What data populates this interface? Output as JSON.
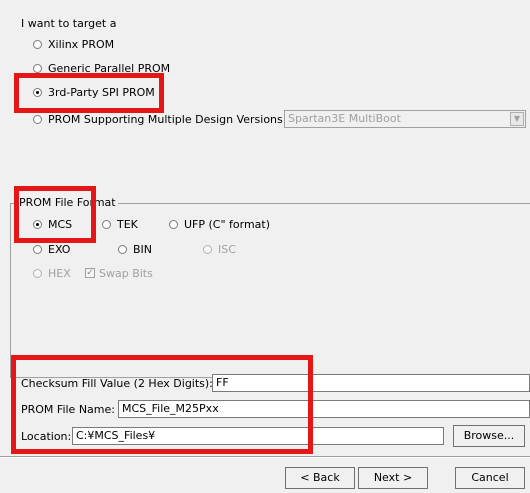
{
  "target": {
    "heading": "I want to target a",
    "options": [
      {
        "label": "Xilinx PROM",
        "selected": false,
        "enabled": true
      },
      {
        "label": "Generic Parallel PROM",
        "selected": false,
        "enabled": true
      },
      {
        "label": "3rd-Party SPI PROM",
        "selected": true,
        "enabled": true
      },
      {
        "label": "PROM Supporting Multiple Design Versions:",
        "selected": false,
        "enabled": true
      }
    ],
    "multiboot_value": "Spartan3E MultiBoot"
  },
  "file_format": {
    "title": "PROM File Format",
    "options": [
      {
        "label": "MCS",
        "selected": true,
        "enabled": true
      },
      {
        "label": "TEK",
        "selected": false,
        "enabled": true
      },
      {
        "label": "UFP (C\" format)",
        "selected": false,
        "enabled": true
      },
      {
        "label": "EXO",
        "selected": false,
        "enabled": true
      },
      {
        "label": "BIN",
        "selected": false,
        "enabled": true
      },
      {
        "label": "ISC",
        "selected": false,
        "enabled": false
      },
      {
        "label": "HEX",
        "selected": false,
        "enabled": false
      }
    ],
    "swap_bits_label": "Swap Bits",
    "swap_bits_checked": true
  },
  "fields": {
    "checksum_label": "Checksum Fill Value (2 Hex Digits):",
    "checksum_value": "FF",
    "prom_name_label": "PROM File Name:",
    "prom_name_value": "MCS_File_M25Pxx",
    "location_label": "Location:",
    "location_value": "C:¥MCS_Files¥",
    "browse_label": "Browse..."
  },
  "nav": {
    "back_label": "< Back",
    "next_label": "Next >",
    "cancel_label": "Cancel"
  },
  "colors": {
    "highlight": "#e51616",
    "panel": "#f0f0f0"
  }
}
